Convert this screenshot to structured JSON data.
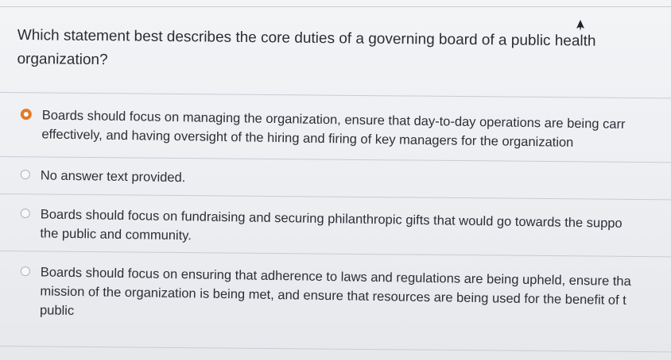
{
  "question": {
    "line1": "Which statement best describes the core duties of a governing board of a public health",
    "line2": "organization?"
  },
  "options": [
    {
      "lines": [
        "Boards should focus on managing the organization, ensure that day-to-day operations are being carr",
        "effectively, and having oversight of the hiring and firing of key managers for the organization"
      ],
      "selected": true
    },
    {
      "lines": [
        "No answer text provided."
      ],
      "selected": false
    },
    {
      "lines": [
        "Boards should focus on fundraising and securing philanthropic gifts that would go towards the suppo",
        "the public and community."
      ],
      "selected": false
    },
    {
      "lines": [
        "Boards should focus on ensuring that adherence to laws and regulations are being upheld, ensure tha",
        "mission of the organization is being met, and ensure that resources are being used for the benefit of t",
        "public"
      ],
      "selected": false
    }
  ],
  "colors": {
    "selected_radio": "#e07a2a",
    "radio_border": "#aeb3bb"
  },
  "icons": {
    "cursor": "mouse-pointer-icon"
  }
}
